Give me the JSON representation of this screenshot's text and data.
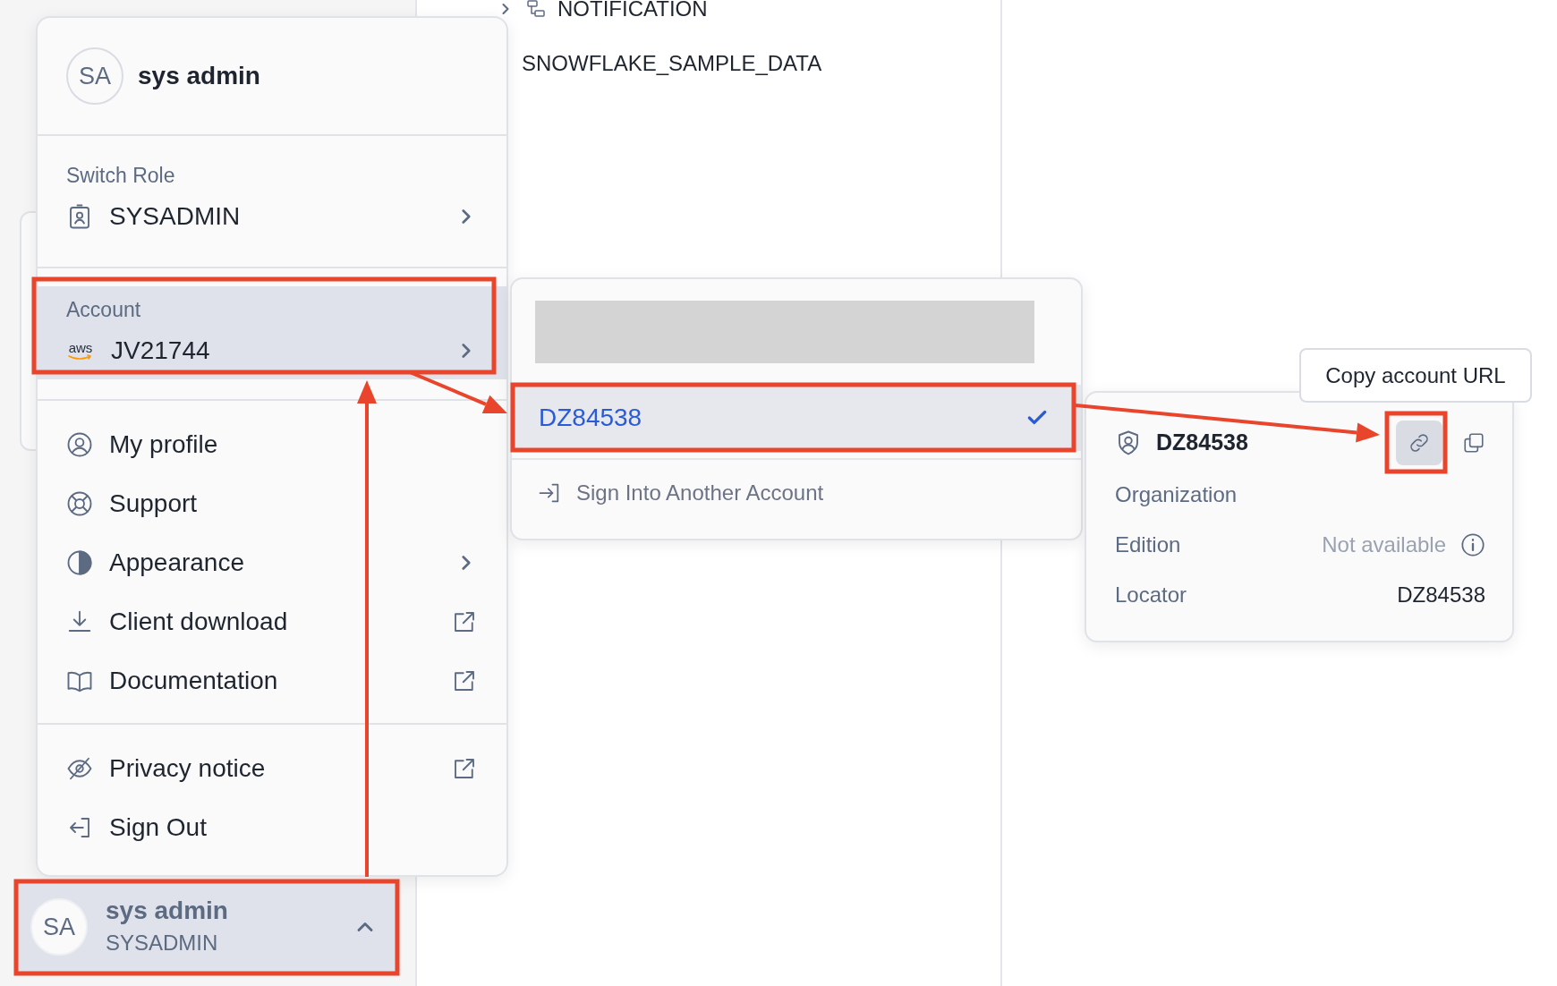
{
  "background": {
    "tree_items": [
      "NOTIFICATION",
      "SNOWFLAKE_SAMPLE_DATA"
    ]
  },
  "profile_menu": {
    "header": {
      "avatar_initials": "SA",
      "name": "sys admin"
    },
    "role_section": {
      "label": "Switch Role",
      "value": "SYSADMIN",
      "selected": false
    },
    "account_section": {
      "label": "Account",
      "logo_text": "aws",
      "value": "JV21744",
      "selected": true
    },
    "items": [
      {
        "label": "My profile",
        "kind": "plain"
      },
      {
        "label": "Support",
        "kind": "plain"
      },
      {
        "label": "Appearance",
        "kind": "submenu"
      },
      {
        "label": "Client download",
        "kind": "external"
      },
      {
        "label": "Documentation",
        "kind": "external"
      }
    ],
    "footer_items": [
      {
        "label": "Privacy notice",
        "kind": "external"
      },
      {
        "label": "Sign Out",
        "kind": "plain"
      }
    ]
  },
  "user_button": {
    "avatar_initials": "SA",
    "name": "sys admin",
    "role": "SYSADMIN",
    "expanded": true
  },
  "account_submenu": {
    "accounts": [
      {
        "label": "DZ84538",
        "selected": true
      }
    ],
    "sign_in_label": "Sign Into Another Account"
  },
  "account_details": {
    "title": "DZ84538",
    "rows": [
      {
        "label": "Organization"
      },
      {
        "label": "Edition",
        "value": "Not available",
        "info": true
      },
      {
        "label": "Locator",
        "value": "DZ84538"
      }
    ]
  },
  "tooltip": "Copy account URL"
}
